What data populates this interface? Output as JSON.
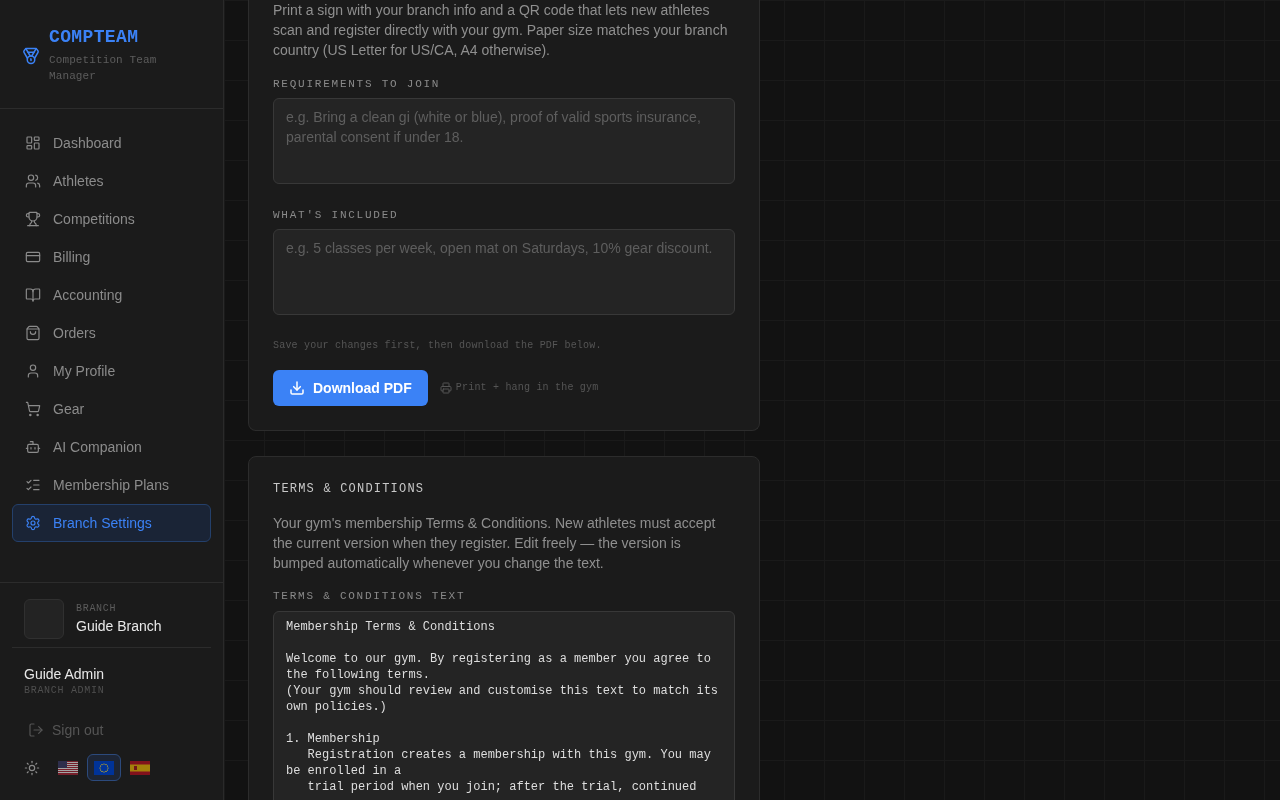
{
  "sidebar": {
    "brand": {
      "name": "COMPTEAM",
      "tagline": "Competition Team Manager"
    },
    "nav": [
      {
        "label": "Dashboard",
        "selected": false
      },
      {
        "label": "Athletes",
        "selected": false
      },
      {
        "label": "Competitions",
        "selected": false
      },
      {
        "label": "Billing",
        "selected": false
      },
      {
        "label": "Accounting",
        "selected": false
      },
      {
        "label": "Orders",
        "selected": false
      },
      {
        "label": "My Profile",
        "selected": false
      },
      {
        "label": "Gear",
        "selected": false
      },
      {
        "label": "AI Companion",
        "selected": false
      },
      {
        "label": "Membership Plans",
        "selected": false
      },
      {
        "label": "Branch Settings",
        "selected": true
      }
    ],
    "branch": {
      "label": "BRANCH",
      "name": "Guide Branch"
    },
    "user": {
      "name": "Guide Admin",
      "role": "BRANCH ADMIN"
    },
    "sign_out": "Sign out",
    "languages": [
      {
        "kind": "us",
        "selected": false
      },
      {
        "kind": "eu",
        "selected": true
      },
      {
        "kind": "es",
        "selected": false
      }
    ]
  },
  "qr_sign_card": {
    "description": "Print a sign with your branch info and a QR code that lets new athletes scan and register directly with your gym. Paper size matches your branch country (US Letter for US/CA, A4 otherwise).",
    "fields": [
      {
        "label": "REQUIREMENTS TO JOIN",
        "placeholder": "e.g. Bring a clean gi (white or blue), proof of valid sports insurance, parental consent if under 18."
      },
      {
        "label": "WHAT'S INCLUDED",
        "placeholder": "e.g. 5 classes per week, open mat on Saturdays, 10% gear discount."
      }
    ],
    "note": "Save your changes first, then download the PDF below.",
    "download_button": "Download PDF",
    "print_hint": "Print + hang in the gym"
  },
  "terms_card": {
    "title": "TERMS & CONDITIONS",
    "description": "Your gym's membership Terms & Conditions. New athletes must accept the current version when they register. Edit freely — the version is bumped automatically whenever you change the text.",
    "field": {
      "label": "TERMS & CONDITIONS TEXT",
      "value": "Membership Terms & Conditions\n\nWelcome to our gym. By registering as a member you agree to the following terms.\n(Your gym should review and customise this text to match its own policies.)\n\n1. Membership\n   Registration creates a membership with this gym. You may be enrolled in a\n   trial period when you join; after the trial, continued"
    }
  }
}
